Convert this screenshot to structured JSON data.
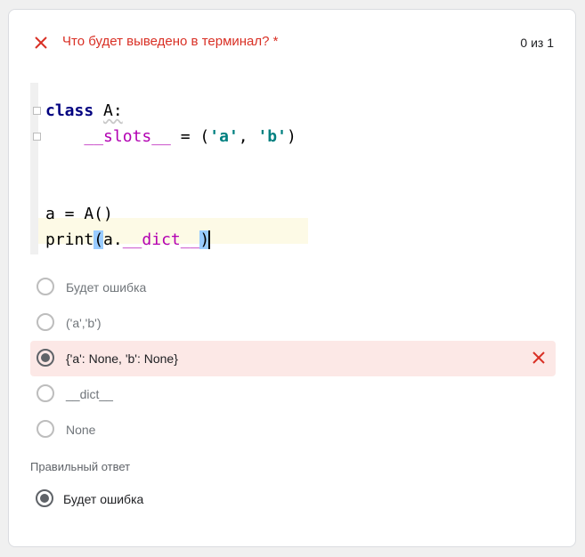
{
  "question": {
    "title": "Что будет выведено в терминал? *",
    "score": "0 из 1"
  },
  "code": {
    "lines": [
      "class A:",
      "    __slots__ = ('a', 'b')",
      "",
      "",
      "a = A()",
      "print(a.__dict__)"
    ]
  },
  "options": [
    {
      "label": "Будет ошибка",
      "selected": false
    },
    {
      "label": "('a','b')",
      "selected": false
    },
    {
      "label": "{'a': None, 'b': None}",
      "selected": true,
      "wrong": true
    },
    {
      "label": "__dict__",
      "selected": false
    },
    {
      "label": "None",
      "selected": false
    }
  ],
  "correct": {
    "title": "Правильный ответ",
    "answer": "Будет ошибка"
  },
  "colors": {
    "error": "#d93025",
    "wrong_bg": "#fce8e6",
    "radio_on": "#5f6368",
    "radio_off": "#bdbdbd"
  }
}
